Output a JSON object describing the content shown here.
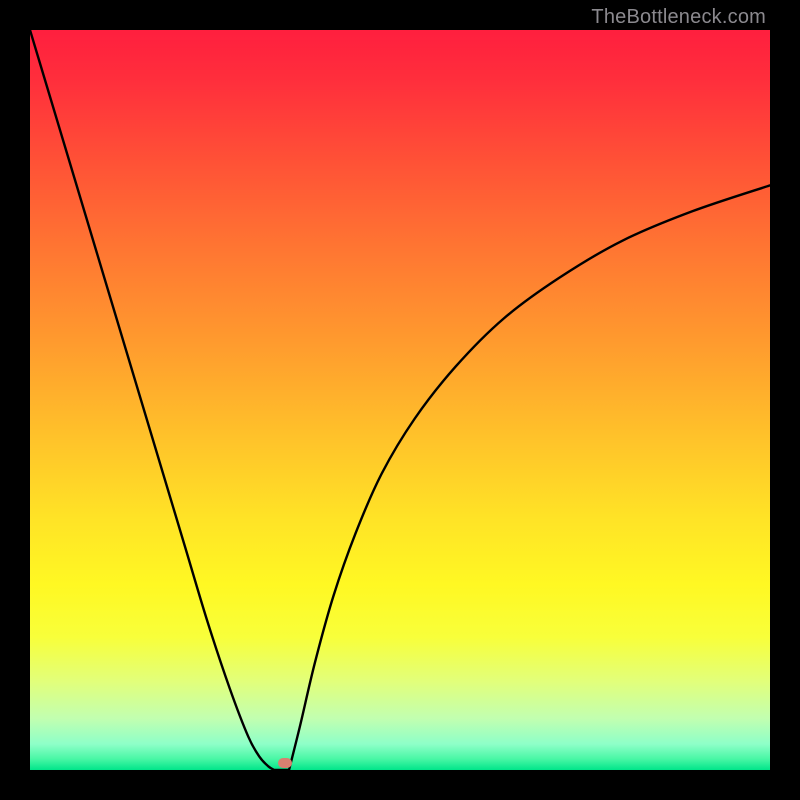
{
  "watermark": "TheBottleneck.com",
  "accent_marker_color": "#d88070",
  "chart_data": {
    "type": "line",
    "title": "",
    "xlabel": "",
    "ylabel": "",
    "xlim": [
      0,
      1
    ],
    "ylim": [
      0,
      1
    ],
    "gradient_stops": [
      {
        "offset": 0.0,
        "color": "#ff1f3e"
      },
      {
        "offset": 0.07,
        "color": "#ff2f3c"
      },
      {
        "offset": 0.18,
        "color": "#ff5236"
      },
      {
        "offset": 0.3,
        "color": "#ff7732"
      },
      {
        "offset": 0.42,
        "color": "#ff9a2e"
      },
      {
        "offset": 0.55,
        "color": "#ffc22a"
      },
      {
        "offset": 0.66,
        "color": "#ffe326"
      },
      {
        "offset": 0.75,
        "color": "#fff823"
      },
      {
        "offset": 0.82,
        "color": "#f8ff3a"
      },
      {
        "offset": 0.88,
        "color": "#e2ff7a"
      },
      {
        "offset": 0.93,
        "color": "#c2ffb0"
      },
      {
        "offset": 0.965,
        "color": "#8effc8"
      },
      {
        "offset": 0.985,
        "color": "#49f7a5"
      },
      {
        "offset": 1.0,
        "color": "#00e58a"
      }
    ],
    "series": [
      {
        "name": "bottleneck-curve-left",
        "x": [
          0.0,
          0.03,
          0.06,
          0.09,
          0.12,
          0.15,
          0.18,
          0.21,
          0.24,
          0.27,
          0.295,
          0.31,
          0.322,
          0.33
        ],
        "y": [
          1.0,
          0.9,
          0.8,
          0.7,
          0.6,
          0.5,
          0.4,
          0.3,
          0.2,
          0.11,
          0.045,
          0.018,
          0.005,
          0.0
        ]
      },
      {
        "name": "bottleneck-curve-right",
        "x": [
          0.35,
          0.365,
          0.385,
          0.41,
          0.44,
          0.475,
          0.52,
          0.575,
          0.64,
          0.715,
          0.8,
          0.895,
          1.0
        ],
        "y": [
          0.0,
          0.06,
          0.145,
          0.235,
          0.32,
          0.4,
          0.475,
          0.545,
          0.61,
          0.665,
          0.715,
          0.755,
          0.79
        ]
      }
    ],
    "valley_flat": {
      "x0": 0.33,
      "x1": 0.35,
      "y": 0.0
    },
    "marker": {
      "x": 0.345,
      "y": 0.01
    }
  }
}
